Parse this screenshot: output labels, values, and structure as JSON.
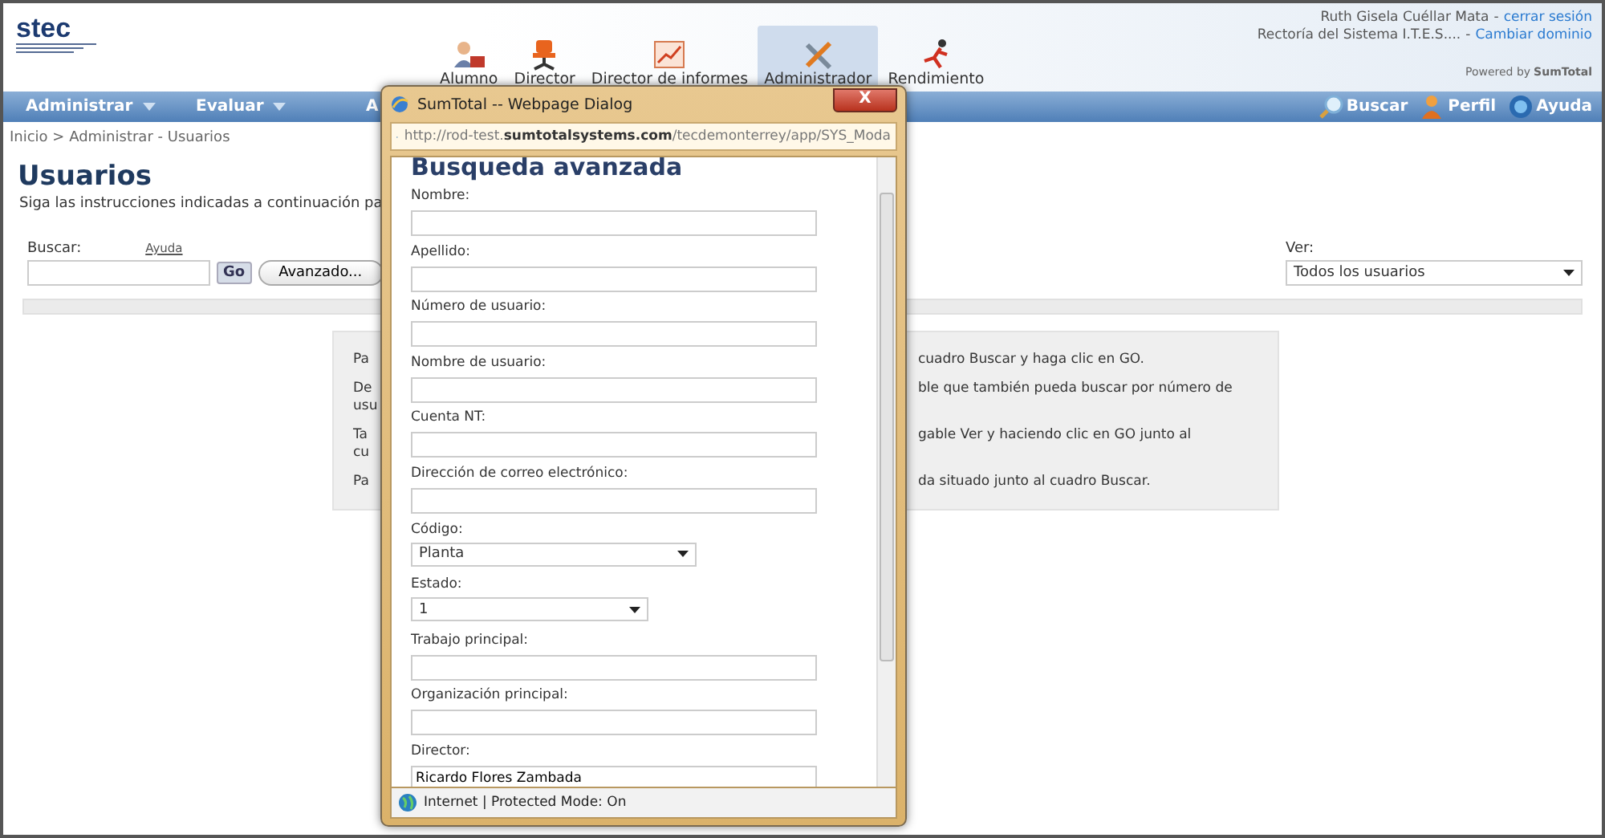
{
  "header": {
    "logo_text": "stec",
    "modules": [
      {
        "label": "Alumno",
        "selected": false
      },
      {
        "label": "Director",
        "selected": false
      },
      {
        "label": "Director de informes",
        "selected": false
      },
      {
        "label": "Administrador",
        "selected": true
      },
      {
        "label": "Rendimiento",
        "selected": false
      }
    ],
    "user_name": "Ruth Gisela Cuéllar Mata",
    "logout_link": "cerrar sesión",
    "domain": "Rectoría del Sistema I.T.E.S....",
    "change_domain_link": "Cambiar dominio",
    "separator": "-",
    "powered_by": "Powered by",
    "powered_brand": "SumTotal"
  },
  "nav": {
    "menus": [
      {
        "label": "Administrar",
        "caret": true
      },
      {
        "label": "Evaluar",
        "caret": true
      },
      {
        "label": "A"
      }
    ],
    "actions": [
      {
        "label": "Buscar"
      },
      {
        "label": "Perfil"
      },
      {
        "label": "Ayuda"
      }
    ]
  },
  "breadcrumb": "Inicio > Administrar - Usuarios",
  "page": {
    "title": "Usuarios",
    "subtitle": "Siga las instrucciones indicadas a continuación pa",
    "search_label": "Buscar:",
    "help_link": "Ayuda",
    "go_button": "Go",
    "advanced_button": "Avanzado...",
    "view_label": "Ver:",
    "view_value": "Todos los usuarios"
  },
  "info": [
    {
      "left": [
        "Pa"
      ],
      "right": [
        "cuadro Buscar y haga clic en GO."
      ]
    },
    {
      "left": [
        "De",
        "usu"
      ],
      "right": [
        "ble que también pueda buscar por número de"
      ]
    },
    {
      "left": [
        "Ta",
        "cu"
      ],
      "right": [
        "gable Ver y haciendo clic en GO junto al"
      ]
    },
    {
      "left": [
        "Pa"
      ],
      "right": [
        "da situado junto al cuadro Buscar."
      ]
    }
  ],
  "dialog": {
    "title": "SumTotal -- Webpage Dialog",
    "close": "X",
    "url_start": "http://rod-test.",
    "url_bold": "sumtotalsystems.com",
    "url_end": "/tecdemonterrey/app/SYS_Moda",
    "heading": "Busqueda avanzada",
    "fields": [
      {
        "label": "Nombre:",
        "kind": "text"
      },
      {
        "label": "Apellido:",
        "kind": "text"
      },
      {
        "label": "Número de usuario:",
        "kind": "text"
      },
      {
        "label": "Nombre de usuario:",
        "kind": "text"
      },
      {
        "label": "Cuenta NT:",
        "kind": "text"
      },
      {
        "label": "Dirección de correo electrónico:",
        "kind": "text"
      },
      {
        "label": "Código:",
        "kind": "select",
        "value": "Planta"
      },
      {
        "label": "Estado:",
        "kind": "select_small",
        "value": "1"
      },
      {
        "label": "Trabajo principal:",
        "kind": "text"
      },
      {
        "label": "Organización principal:",
        "kind": "text"
      },
      {
        "label": "Director:",
        "kind": "text",
        "value": "Ricardo Flores Zambada"
      }
    ],
    "status": "Internet | Protected Mode: On"
  }
}
